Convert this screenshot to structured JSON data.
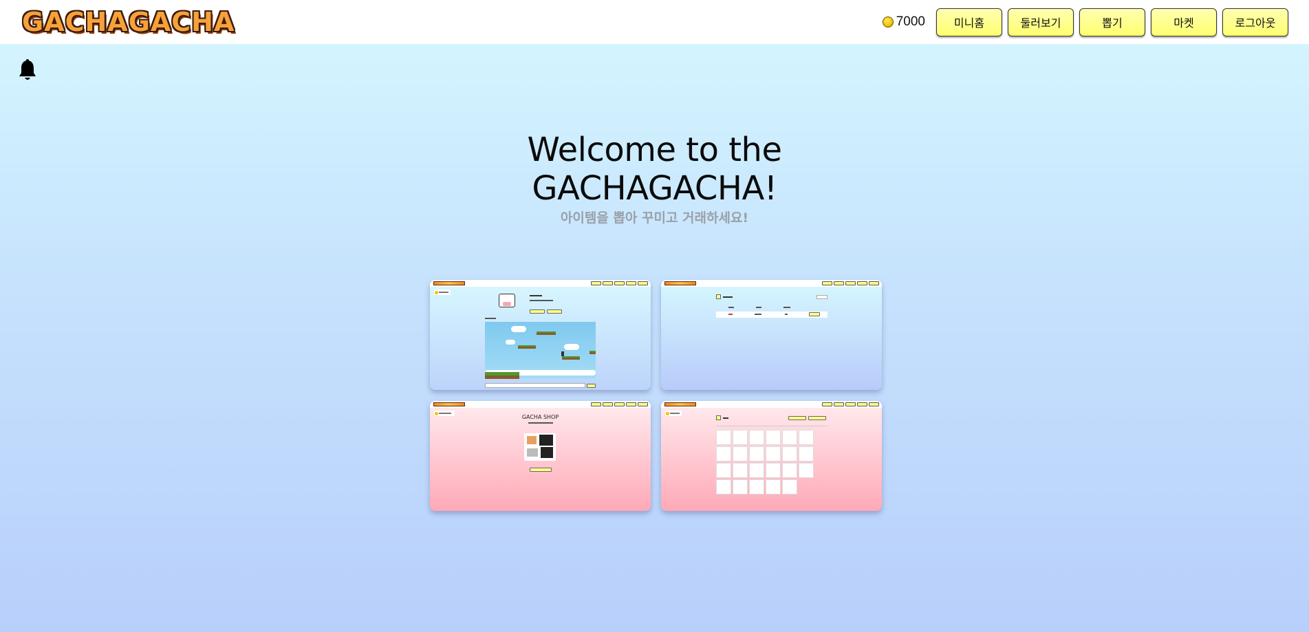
{
  "header": {
    "logo_text": "GACHAGACHA",
    "coin_amount": "7000",
    "nav": [
      "미니홈",
      "둘러보기",
      "뽑기",
      "마켓",
      "로그아웃"
    ]
  },
  "hero": {
    "title_line1": "Welcome to the",
    "title_line2": "GACHAGACHA!",
    "subtitle": "아이템을 뽑아 꾸미고 거래하세요!"
  },
  "previews": {
    "shop_title": "GACHA SHOP"
  },
  "colors": {
    "nav_button": "#ffff88",
    "coin": "#f2c300",
    "bg_blue_top": "#d6f8ff",
    "bg_blue_bottom": "#b8cffb",
    "pink_bottom": "#ffa9b7"
  },
  "icons": [
    "coin-icon",
    "bell-icon"
  ]
}
